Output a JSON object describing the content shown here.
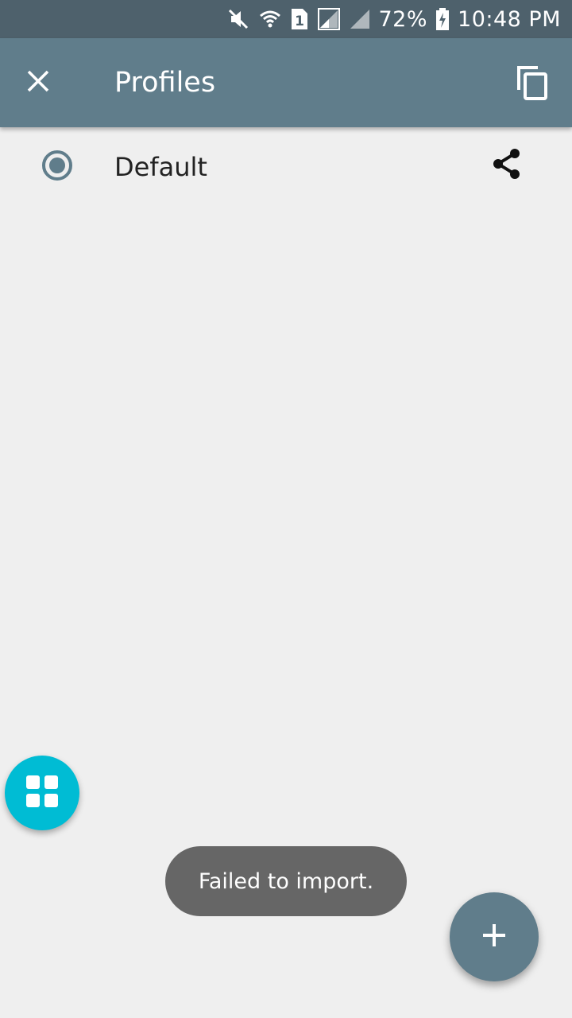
{
  "status_bar": {
    "battery_text": "72%",
    "time": "10:48 PM",
    "sim_number": "1",
    "icons": [
      "mute-icon",
      "wifi-icon",
      "sim-1-icon",
      "signal-icon",
      "signal-icon",
      "battery-charging-icon"
    ]
  },
  "app_bar": {
    "title": "Profiles",
    "close_icon": "close-icon",
    "copy_icon": "copy-icon"
  },
  "profiles": [
    {
      "name": "Default",
      "selected": true,
      "share_icon": "share-icon"
    }
  ],
  "toast": {
    "message": "Failed to import."
  },
  "fabs": {
    "grid_icon": "grid-icon",
    "add_icon": "add-icon"
  },
  "colors": {
    "status_bar": "#4e616c",
    "app_bar": "#607d8b",
    "background": "#efefef",
    "grid_fab": "#00bcd4",
    "add_fab": "#607d8b",
    "toast_bg": "#666666"
  }
}
